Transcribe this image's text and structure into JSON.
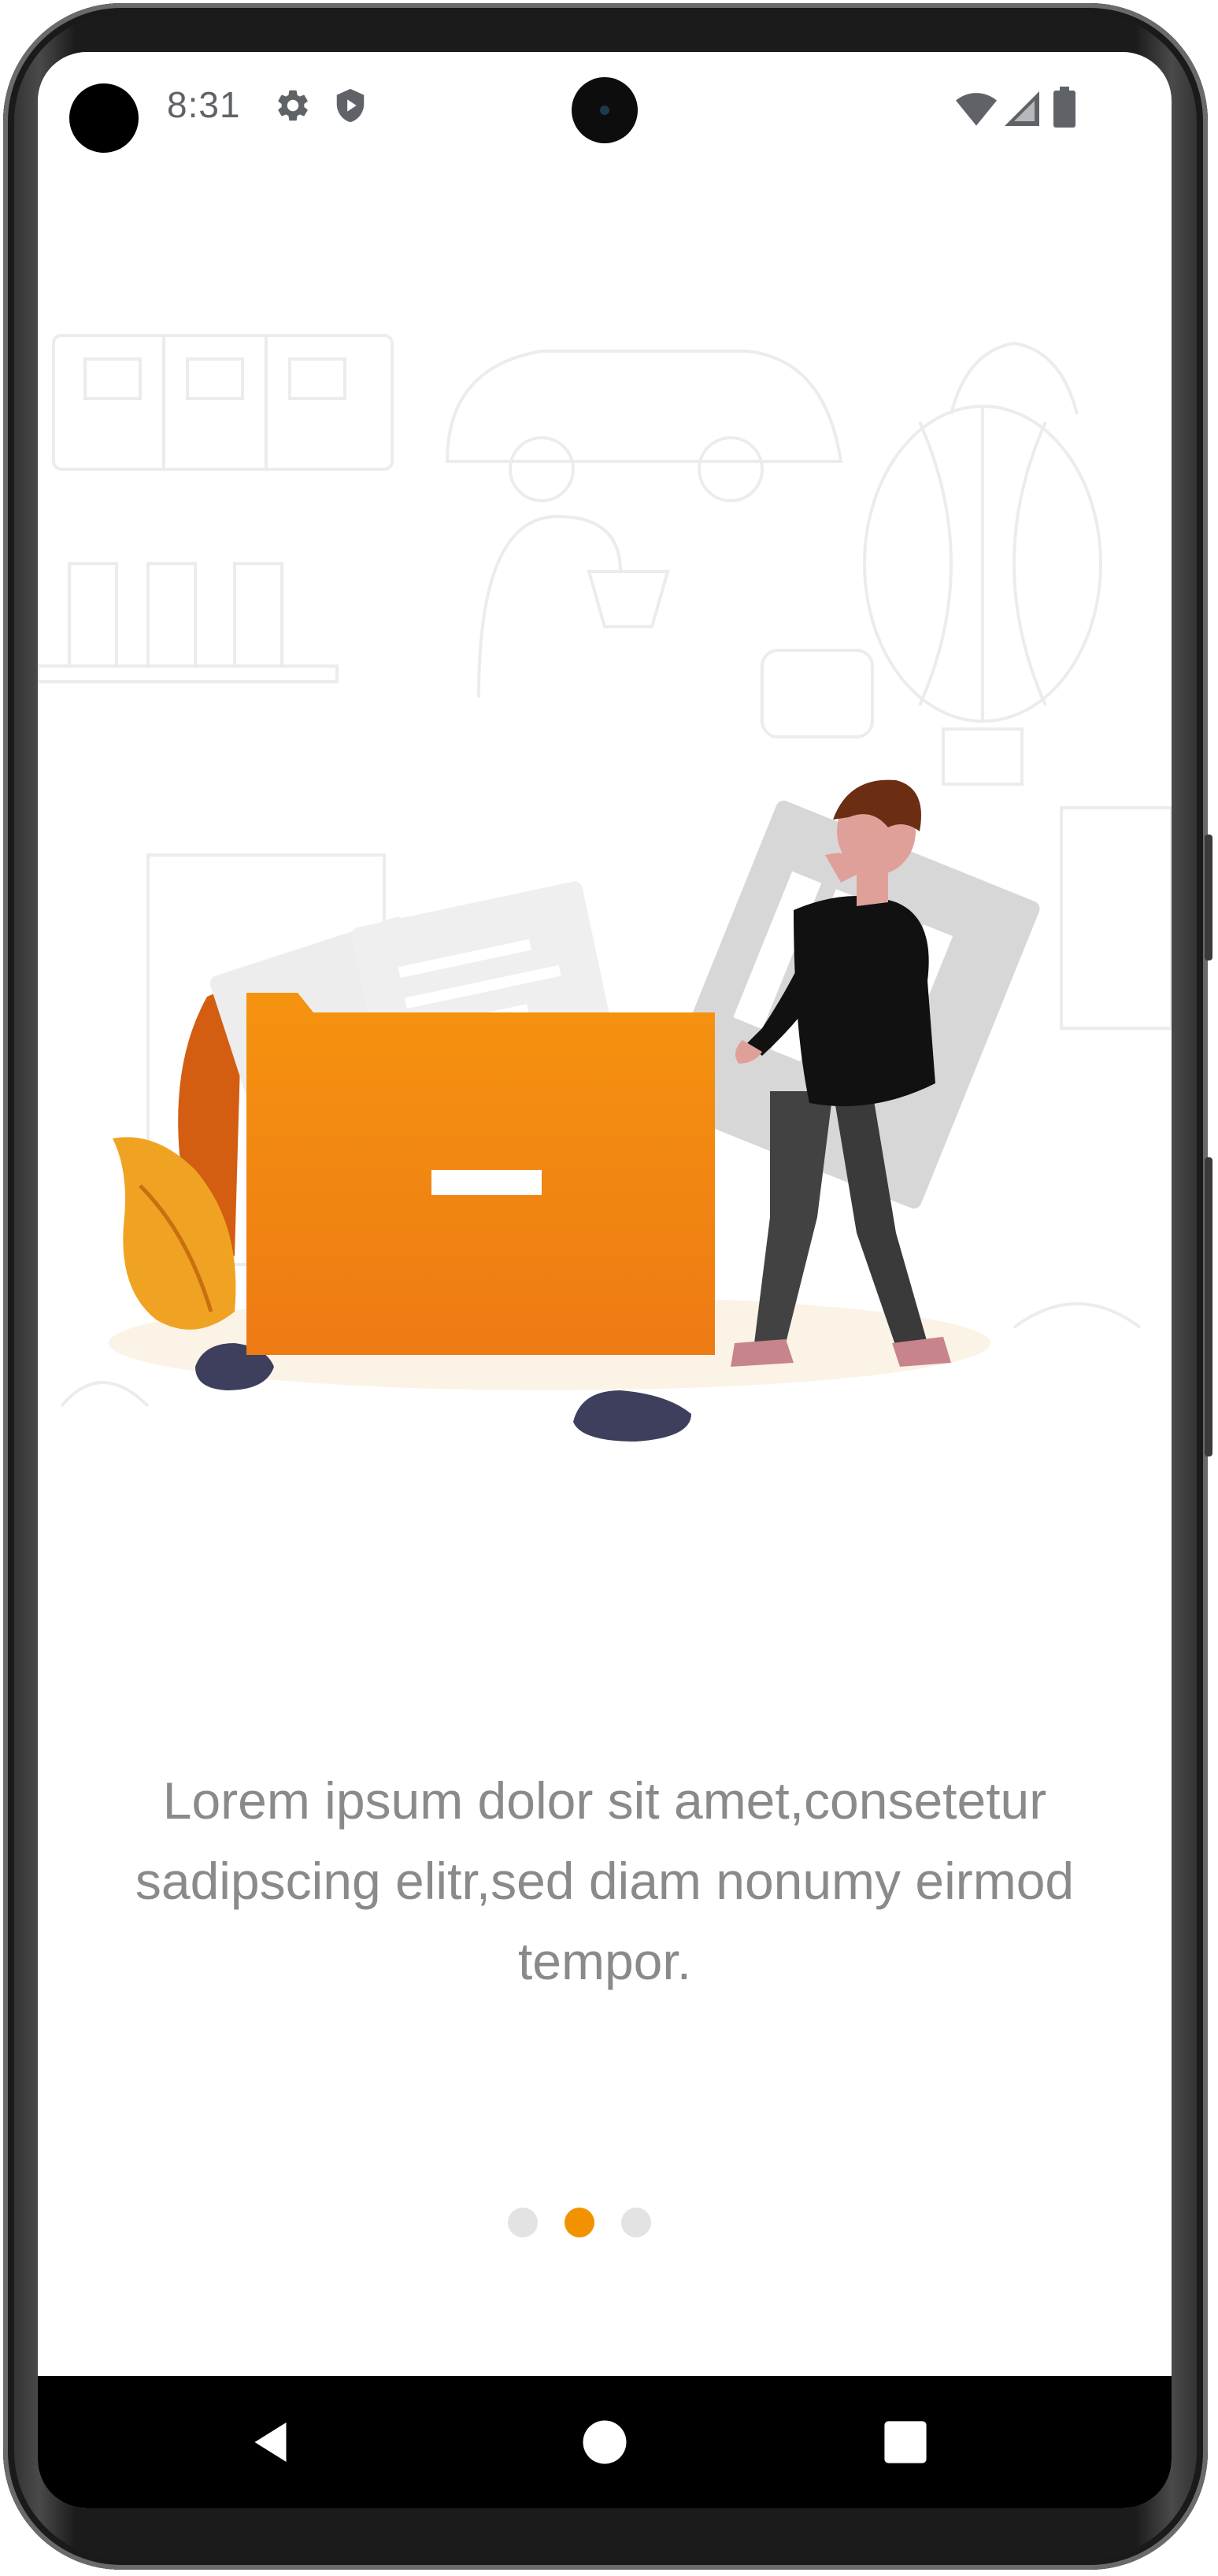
{
  "status_bar": {
    "time": "8:31",
    "icons": [
      "settings-icon",
      "shield-icon",
      "wifi-icon",
      "signal-icon",
      "battery-icon"
    ]
  },
  "onboarding": {
    "illustration": "person-filing-documents-illustration",
    "description": "Lorem ipsum dolor sit amet,consetetur sadipscing elitr,sed diam nonumy eirmod tempor.",
    "pager": {
      "total": 3,
      "active_index": 1
    }
  },
  "nav_bar": {
    "buttons": [
      "back-icon",
      "home-icon",
      "recents-icon"
    ]
  },
  "colors": {
    "accent": "#f39200",
    "inactive_dot": "#e3e3e3",
    "text": "#8a8a8a"
  }
}
